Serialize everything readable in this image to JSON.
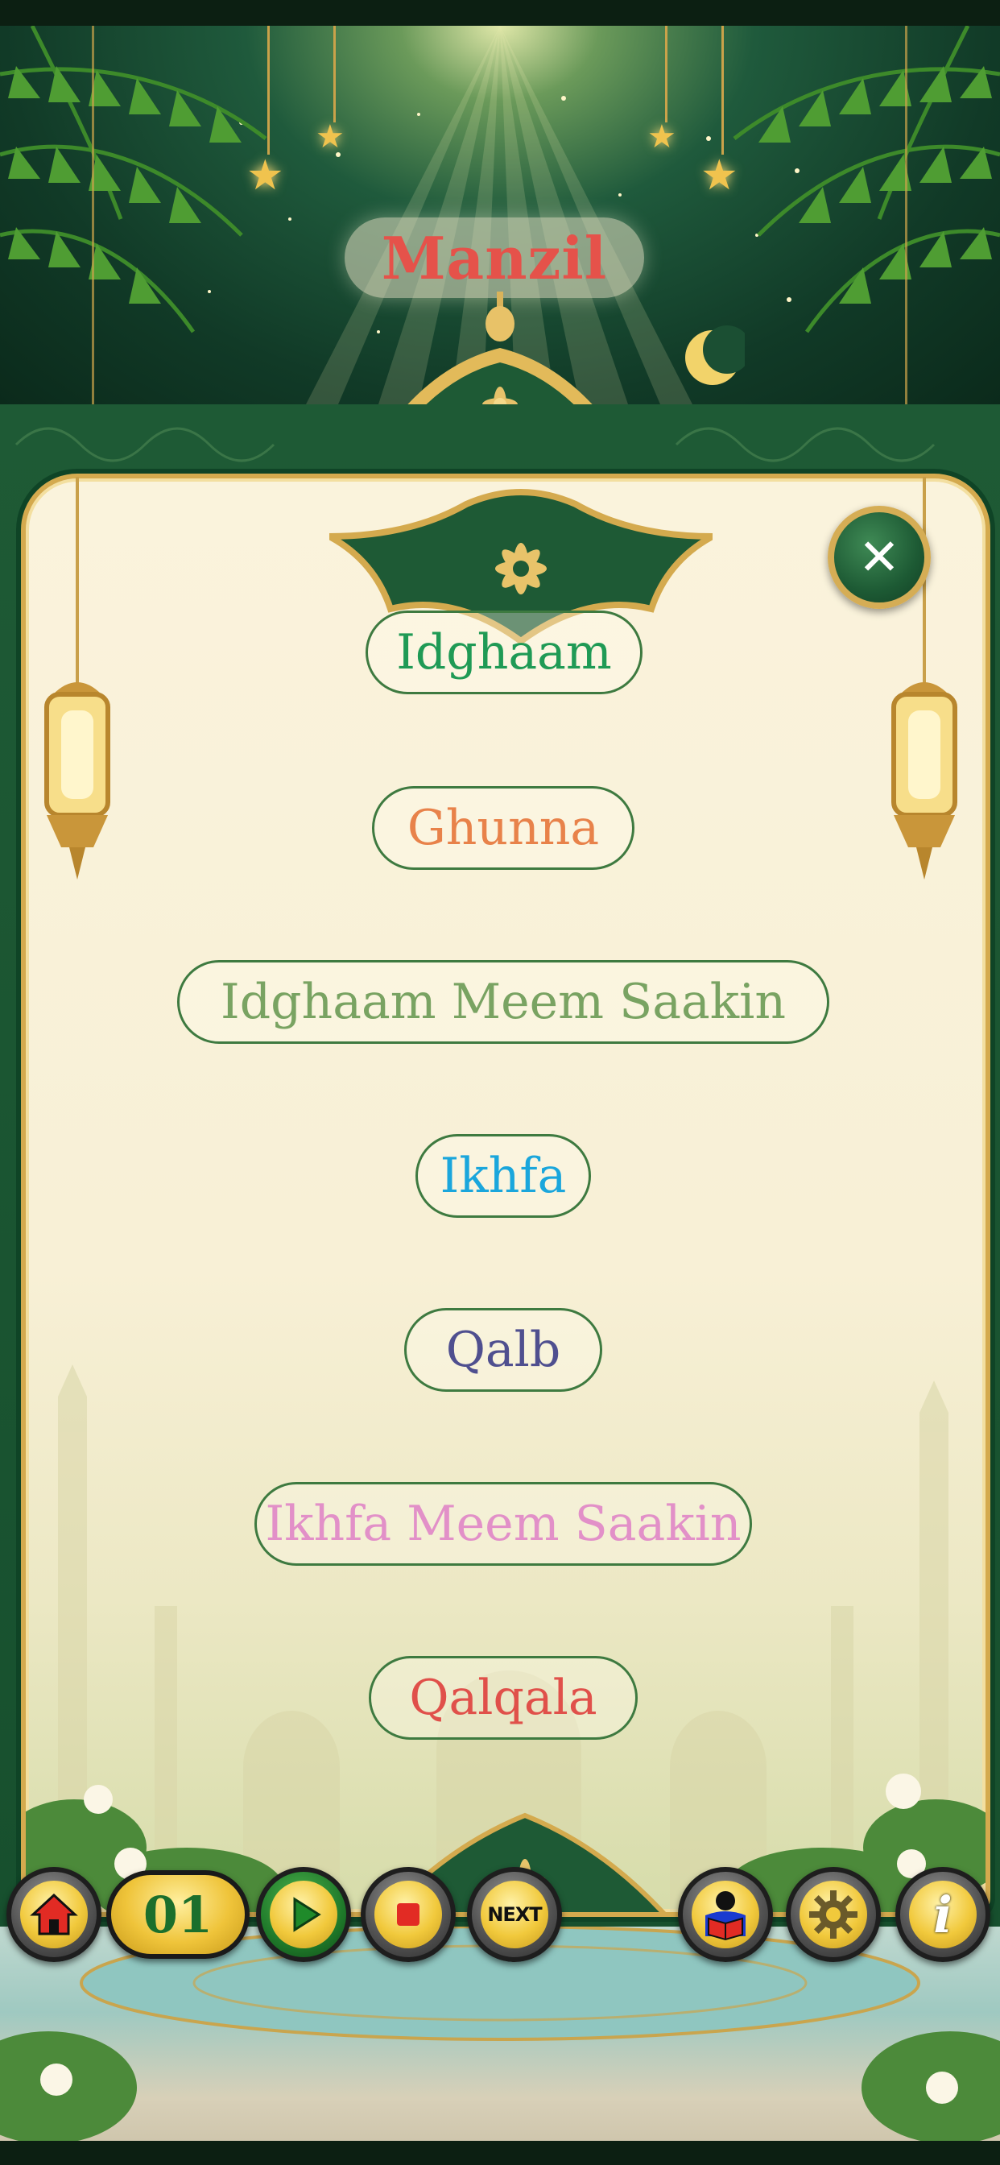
{
  "header": {
    "title": "Manzil"
  },
  "rules": [
    {
      "label": "Idghaam",
      "color": "#1f9a55"
    },
    {
      "label": "Ghunna",
      "color": "#e8824a"
    },
    {
      "label": "Idghaam Meem Saakin",
      "color": "#79a362"
    },
    {
      "label": "Ikhfa",
      "color": "#1aa6dc"
    },
    {
      "label": "Qalb",
      "color": "#4f4f8f"
    },
    {
      "label": "Ikhfa Meem Saakin",
      "color": "#e290c8"
    },
    {
      "label": "Qalqala",
      "color": "#e0504a"
    }
  ],
  "toolbar": {
    "counter": "01",
    "next_label": "NEXT",
    "info_label": "i"
  },
  "colors": {
    "title": "#e5524a",
    "frame_green": "#1e5a35",
    "gold": "#d4aa4e",
    "parchment": "#f8f0d6"
  }
}
